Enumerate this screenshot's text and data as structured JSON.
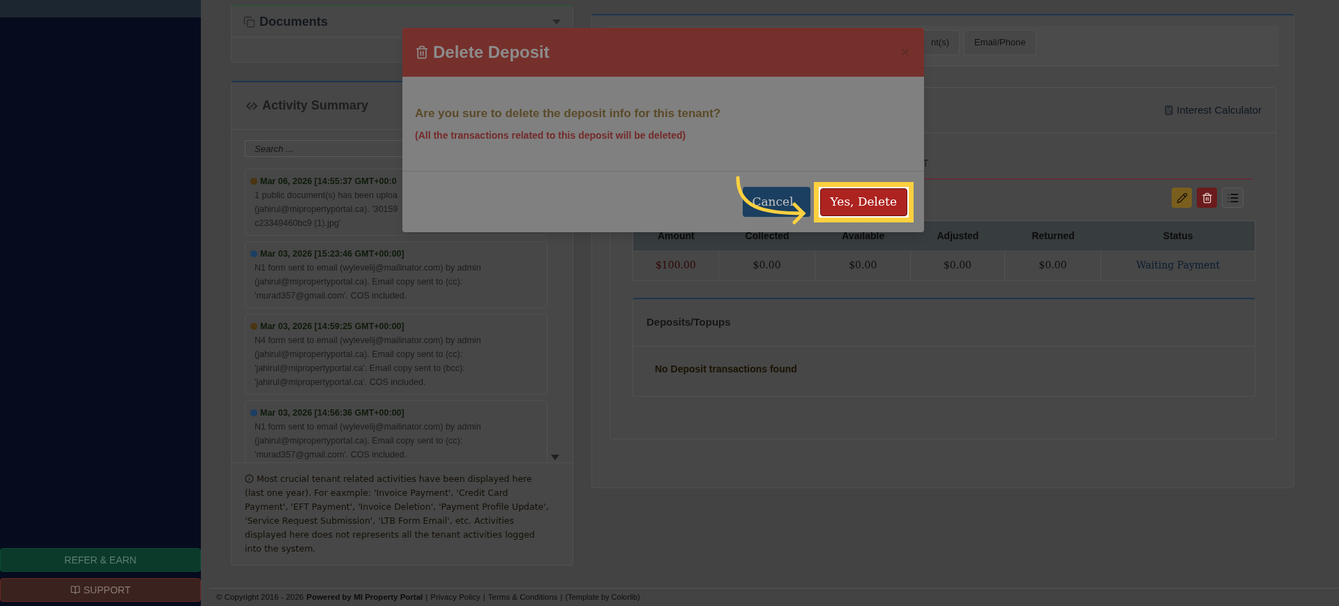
{
  "sidebar": {
    "buttons": [
      {
        "label": "REFER & EARN",
        "kind": "refer"
      },
      {
        "label": "SUPPORT",
        "kind": "support"
      }
    ]
  },
  "documents_panel": {
    "title": "Documents"
  },
  "activity_summary": {
    "title": "Activity Summary",
    "search": {
      "placeholder": "Search ..."
    },
    "entries": [
      {
        "timestamp": "Mar 06, 2026 [14:55:37 GMT+00:0",
        "color": "#4a3512",
        "lines": [
          "1 public document(s) has been uploa",
          "(jahirul@mipropertyportal.ca). '30159",
          "c23349460bc9 (1).jpg'"
        ]
      },
      {
        "timestamp": "Mar 03, 2026 [15:23:46 GMT+00:00]",
        "color": "#1b3f63",
        "lines": [
          "N1 form sent to email (wylevelij@mailinator.com) by admin",
          "(jahirul@mipropertyportal.ca). Email copy sent to (cc):",
          "'murad357@gmail.com'. COS included."
        ]
      },
      {
        "timestamp": "Mar 03, 2026 [14:59:25 GMT+00:00]",
        "color": "#4a3512",
        "lines": [
          "N4 form sent to email (wylevelij@mailinator.com) by admin",
          "(jahirul@mipropertyportal.ca). Email copy sent to (cc):",
          "'jahirul@mipropertyportal.ca'. Email copy sent to (bcc):",
          "'jahirul@mipropertyportal.ca'. COS included."
        ]
      },
      {
        "timestamp": "Mar 03, 2026 [14:56:36 GMT+00:00]",
        "color": "#1b3f63",
        "lines": [
          "N1 form sent to email (wylevelij@mailinator.com) by admin",
          "(jahirul@mipropertyportal.ca). Email copy sent to (cc):",
          "'murad357@gmail.com'. COS included."
        ]
      }
    ],
    "note": "Most crucial tenant related activities have been displayed here (last one year). For eaxmple: 'Invoice Payment', 'Credit Card Payment', 'EFT Payment', 'Invoice Deletion', 'Payment Profile Update', 'Service Request Submission', 'LTB Form Email', etc. Activities displayed here does not represents all the tenant activities logged into the system."
  },
  "tenant_tabs": [
    {
      "label": "nt(s)",
      "selected": false
    },
    {
      "label": "Email/Phone",
      "selected": false
    }
  ],
  "deposit_card": {
    "link": "Interest Calculator",
    "subtab": "T",
    "actions": [
      {
        "kind": "edit"
      },
      {
        "kind": "delete"
      },
      {
        "kind": "list"
      }
    ],
    "table": {
      "columns": [
        "Amount",
        "Collected",
        "Available",
        "Adjusted",
        "Returned",
        "Status"
      ],
      "rows": [
        {
          "cells": [
            "$100.00",
            "$0.00",
            "$0.00",
            "$0.00",
            "$0.00",
            "Waiting Payment"
          ]
        }
      ]
    },
    "transactions": {
      "title": "Deposits/Topups",
      "empty_message": "No Deposit transactions found"
    }
  },
  "modal": {
    "title": "Delete Deposit",
    "question": "Are you sure to delete the deposit info for this tenant?",
    "warning": "(All the transactions related to this deposit will be deleted)",
    "buttons": [
      {
        "label": "Cancel",
        "kind": "cancel",
        "highlighted": false
      },
      {
        "label": "Yes, Delete",
        "kind": "confirm",
        "highlighted": true
      }
    ]
  },
  "footer": [
    {
      "text": "© Copyright 2016 - 2026",
      "kind": "text"
    },
    {
      "text": "Powered by MI Property Portal",
      "kind": "brand"
    },
    {
      "text": "|",
      "kind": "separator"
    },
    {
      "text": "Privacy Policy",
      "kind": "link"
    },
    {
      "text": "|",
      "kind": "separator"
    },
    {
      "text": "Terms & Conditions",
      "kind": "link"
    },
    {
      "text": "|",
      "kind": "separator"
    },
    {
      "text": "(Template by Colorlib)",
      "kind": "note"
    }
  ]
}
